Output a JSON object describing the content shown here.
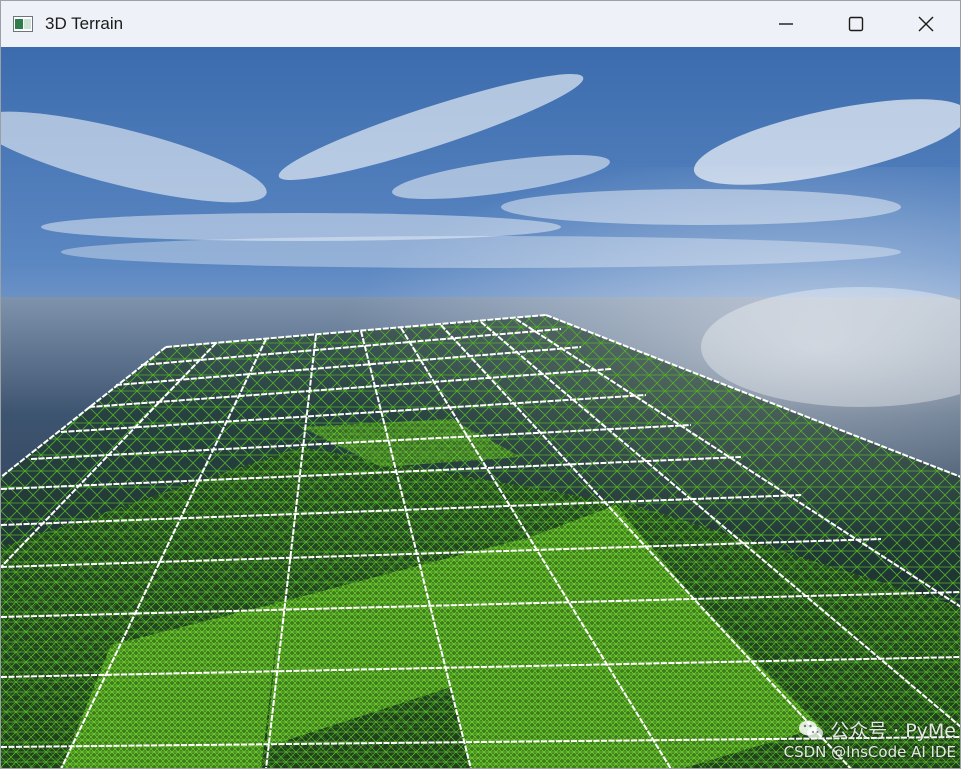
{
  "window": {
    "title": "3D Terrain",
    "app_icon": "window-app-icon",
    "controls": {
      "minimize_icon": "minimize-icon",
      "maximize_icon": "maximize-icon",
      "close_icon": "close-icon"
    }
  },
  "scene": {
    "description_icons": [
      "sky-background",
      "terrain-grid"
    ],
    "colors": {
      "sky_top": "#3f6fb0",
      "horizon": "#d8dee6",
      "water": "#2a3a4e",
      "terrain_fill": "#3a6a1e",
      "terrain_wire": "#5fbf2a",
      "grid_lines": "#ffffff"
    }
  },
  "watermark": {
    "line1": "公众号 · PyMe",
    "line2": "CSDN @InsCode AI IDE",
    "icon": "wechat-icon"
  }
}
